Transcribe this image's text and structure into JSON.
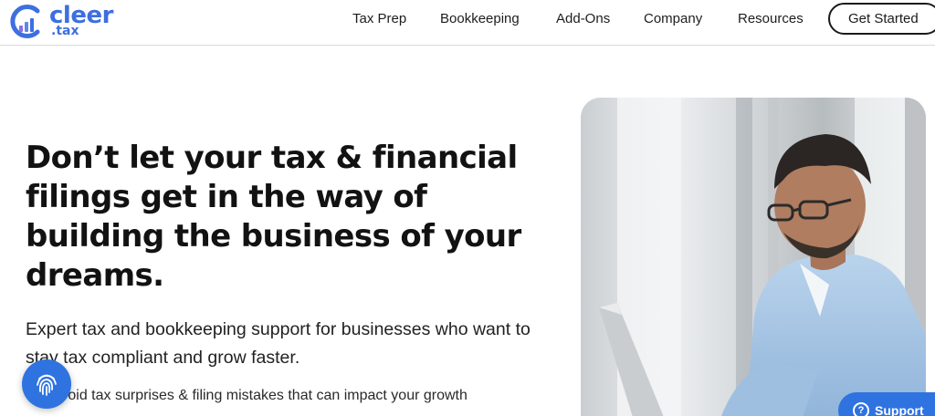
{
  "header": {
    "logo": {
      "word": "cleer",
      "sub": ".tax"
    },
    "nav": [
      "Tax Prep",
      "Bookkeeping",
      "Add-Ons",
      "Company",
      "Resources"
    ],
    "cta_label": "Get Started"
  },
  "hero": {
    "headline": "Don’t let your tax & financial filings get in the way of building the business of your dreams.",
    "subline": "Expert tax and bookkeeping support for businesses who want to stay tax compliant and grow faster.",
    "bullet": "Avoid tax surprises & filing mistakes that can impact your growth"
  },
  "widgets": {
    "fingerprint_icon": "fingerprint-icon",
    "support_label": "Support"
  },
  "colors": {
    "brand_blue": "#3d6fe0",
    "button_blue": "#2f73e0",
    "text_dark": "#121212"
  }
}
